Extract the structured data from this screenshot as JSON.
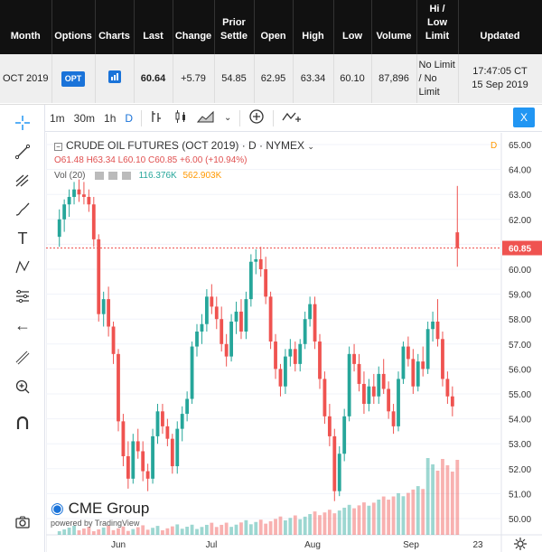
{
  "quote": {
    "headers": {
      "month": "Month",
      "options": "Options",
      "charts": "Charts",
      "last": "Last",
      "change": "Change",
      "prior_settle": "Prior Settle",
      "open": "Open",
      "high": "High",
      "low": "Low",
      "volume": "Volume",
      "hilo": "Hi / Low Limit",
      "updated": "Updated"
    },
    "row": {
      "month": "OCT 2019",
      "options": "OPT",
      "last": "60.64",
      "change": "+5.79",
      "prior_settle": "54.85",
      "open": "62.95",
      "high": "63.34",
      "low": "60.10",
      "volume": "87,896",
      "hilo": "No Limit / No Limit",
      "updated_time": "17:47:05 CT",
      "updated_date": "15 Sep 2019"
    }
  },
  "toolbar": {
    "intervals": [
      "1m",
      "30m",
      "1h",
      "D"
    ],
    "active_interval": "D",
    "close_label": "X"
  },
  "legend": {
    "title": "CRUDE OIL FUTURES (OCT 2019) · D · NYMEX",
    "period_badge": "D",
    "ohlc": "O61.48 H63.34 L60.10 C60.85 +6.00 (+10.94%)",
    "vol_label": "Vol (20)",
    "vol_values": "116.376K",
    "vol_ma": "562.903K"
  },
  "branding": {
    "logo": "CME Group",
    "powered": "powered by TradingView"
  },
  "colors": {
    "up": "#26a69a",
    "down": "#ef5350",
    "accent": "#1a73d9"
  },
  "chart_data": {
    "type": "candlestick",
    "price_axis": [
      "65.00",
      "64.00",
      "63.00",
      "62.00",
      "61.00",
      "60.00",
      "59.00",
      "58.00",
      "57.00",
      "56.00",
      "55.00",
      "54.00",
      "53.00",
      "52.00",
      "51.00",
      "50.00"
    ],
    "time_axis": [
      "Jun",
      "Jul",
      "Aug",
      "Sep",
      "23"
    ],
    "last_price": "60.85",
    "ylim": [
      49.5,
      65.5
    ],
    "candles": [
      [
        61.3,
        62.4,
        60.9,
        62.0
      ],
      [
        62.0,
        62.8,
        61.5,
        62.6
      ],
      [
        62.6,
        63.2,
        62.1,
        62.9
      ],
      [
        62.9,
        63.5,
        62.6,
        63.2
      ],
      [
        63.2,
        63.6,
        62.7,
        63.0
      ],
      [
        63.0,
        63.5,
        62.6,
        62.9
      ],
      [
        62.9,
        63.2,
        62.3,
        62.6
      ],
      [
        62.6,
        62.9,
        60.9,
        61.2
      ],
      [
        61.2,
        61.4,
        57.9,
        58.2
      ],
      [
        58.2,
        59.1,
        57.7,
        58.8
      ],
      [
        58.8,
        59.3,
        57.3,
        57.7
      ],
      [
        57.7,
        57.9,
        56.2,
        56.6
      ],
      [
        56.6,
        56.8,
        53.5,
        53.9
      ],
      [
        53.9,
        54.2,
        52.1,
        52.5
      ],
      [
        52.5,
        53.1,
        51.2,
        51.6
      ],
      [
        51.6,
        53.4,
        51.4,
        53.1
      ],
      [
        53.1,
        53.6,
        52.4,
        52.7
      ],
      [
        52.7,
        53.1,
        51.5,
        51.9
      ],
      [
        51.9,
        52.2,
        51.1,
        51.6
      ],
      [
        51.6,
        53.6,
        51.4,
        53.3
      ],
      [
        53.3,
        54.6,
        53.0,
        54.3
      ],
      [
        54.3,
        54.6,
        53.4,
        53.7
      ],
      [
        53.7,
        54.0,
        52.9,
        53.2
      ],
      [
        53.2,
        53.4,
        51.8,
        52.1
      ],
      [
        52.1,
        53.9,
        51.8,
        53.6
      ],
      [
        53.6,
        54.5,
        53.1,
        54.2
      ],
      [
        54.2,
        55.1,
        53.9,
        54.8
      ],
      [
        54.8,
        57.1,
        54.6,
        56.9
      ],
      [
        56.9,
        57.8,
        56.5,
        57.5
      ],
      [
        57.5,
        58.2,
        57.0,
        57.8
      ],
      [
        57.8,
        59.2,
        57.5,
        58.9
      ],
      [
        58.9,
        59.4,
        58.2,
        58.5
      ],
      [
        58.5,
        58.9,
        57.6,
        58.0
      ],
      [
        58.0,
        58.5,
        56.7,
        57.0
      ],
      [
        57.0,
        57.4,
        56.1,
        56.5
      ],
      [
        56.5,
        58.2,
        56.3,
        57.9
      ],
      [
        57.9,
        58.7,
        57.4,
        58.3
      ],
      [
        58.3,
        58.8,
        57.2,
        57.5
      ],
      [
        57.5,
        59.1,
        57.2,
        58.8
      ],
      [
        58.8,
        60.6,
        58.5,
        60.3
      ],
      [
        60.3,
        60.8,
        59.8,
        60.4
      ],
      [
        60.4,
        60.9,
        59.7,
        60.0
      ],
      [
        60.0,
        60.5,
        58.6,
        58.9
      ],
      [
        58.9,
        59.1,
        56.8,
        57.1
      ],
      [
        57.1,
        57.4,
        55.6,
        56.0
      ],
      [
        56.0,
        56.2,
        54.9,
        55.3
      ],
      [
        55.3,
        56.8,
        55.0,
        56.5
      ],
      [
        56.5,
        57.2,
        56.1,
        56.8
      ],
      [
        56.8,
        57.1,
        55.9,
        56.2
      ],
      [
        56.2,
        57.2,
        55.9,
        57.0
      ],
      [
        57.0,
        58.3,
        56.8,
        58.0
      ],
      [
        58.0,
        58.9,
        57.7,
        58.6
      ],
      [
        58.6,
        58.9,
        56.8,
        57.1
      ],
      [
        57.1,
        57.4,
        55.2,
        55.6
      ],
      [
        55.6,
        55.9,
        53.8,
        54.1
      ],
      [
        54.1,
        54.6,
        52.9,
        53.3
      ],
      [
        53.3,
        53.6,
        50.7,
        51.1
      ],
      [
        51.1,
        52.9,
        50.9,
        52.6
      ],
      [
        52.6,
        54.4,
        52.3,
        54.1
      ],
      [
        54.1,
        56.9,
        53.9,
        56.6
      ],
      [
        56.6,
        57.0,
        55.9,
        56.2
      ],
      [
        56.2,
        56.6,
        55.1,
        55.4
      ],
      [
        55.4,
        55.9,
        54.2,
        54.6
      ],
      [
        54.6,
        55.6,
        54.3,
        55.3
      ],
      [
        55.3,
        55.8,
        54.6,
        54.9
      ],
      [
        54.9,
        56.1,
        54.6,
        55.8
      ],
      [
        55.8,
        56.4,
        55.0,
        55.2
      ],
      [
        55.2,
        55.5,
        54.0,
        54.3
      ],
      [
        54.3,
        54.6,
        53.4,
        53.7
      ],
      [
        53.7,
        55.9,
        53.5,
        55.6
      ],
      [
        55.6,
        57.1,
        55.4,
        56.9
      ],
      [
        56.9,
        57.3,
        56.1,
        56.4
      ],
      [
        56.4,
        56.8,
        55.0,
        55.3
      ],
      [
        55.3,
        56.6,
        55.1,
        56.3
      ],
      [
        56.3,
        56.9,
        55.7,
        56.0
      ],
      [
        56.0,
        57.9,
        55.8,
        57.6
      ],
      [
        57.6,
        58.3,
        57.1,
        57.9
      ],
      [
        57.9,
        58.8,
        56.9,
        57.2
      ],
      [
        57.2,
        57.5,
        55.3,
        55.6
      ],
      [
        55.6,
        55.9,
        54.6,
        54.9
      ],
      [
        54.9,
        55.3,
        54.1,
        54.5
      ],
      [
        61.48,
        63.34,
        60.1,
        60.85
      ]
    ],
    "volume_scale": 1
  }
}
